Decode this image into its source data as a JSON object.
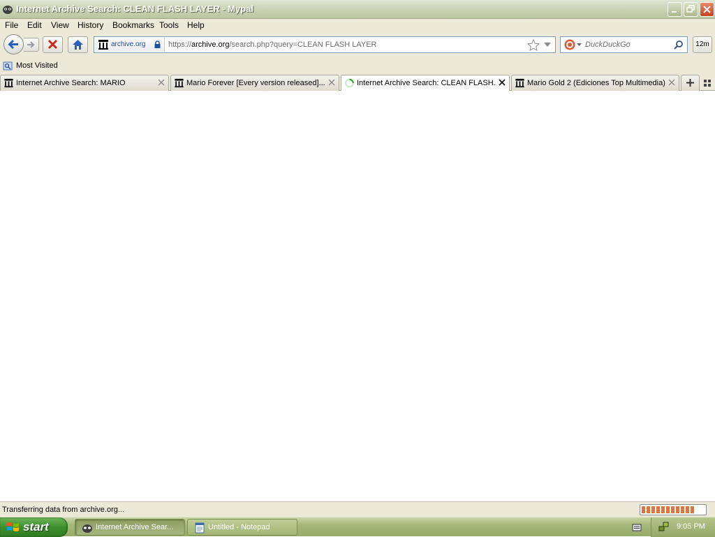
{
  "window": {
    "title": "Internet Archive Search: CLEAN FLASH LAYER - Mypal"
  },
  "menu": [
    "File",
    "Edit",
    "View",
    "History",
    "Bookmarks",
    "Tools",
    "Help"
  ],
  "navbar": {
    "identity_host": "archive.org",
    "url_scheme": "https://",
    "url_host": "archive.org",
    "url_path": "/search.php?query=CLEAN FLASH LAYER",
    "search_placeholder": "DuckDuckGo",
    "timer_label": "12m"
  },
  "bookmarks": {
    "most_visited": "Most Visited"
  },
  "tabs": [
    {
      "label": "Internet Archive Search: MARIO",
      "active": false
    },
    {
      "label": "Mario Forever [Every version released]...",
      "active": false
    },
    {
      "label": "Internet Archive Search: CLEAN FLASH...",
      "active": true
    },
    {
      "label": "Mario Gold 2 (Ediciones Top Multimedia)...",
      "active": false
    }
  ],
  "status": {
    "text": "Transferring data from archive.org...",
    "progress": 0.85
  },
  "taskbar": {
    "start_label": "start",
    "tasks": [
      {
        "label": "Internet Archive Sear...",
        "active": true
      },
      {
        "label": "Untitled - Notepad",
        "active": false
      }
    ],
    "clock": "9:05 PM"
  },
  "colors": {
    "accent_blue": "#1c4f9c",
    "progress_orange": "#e2733a",
    "chrome_bg": "#ece9d8"
  }
}
